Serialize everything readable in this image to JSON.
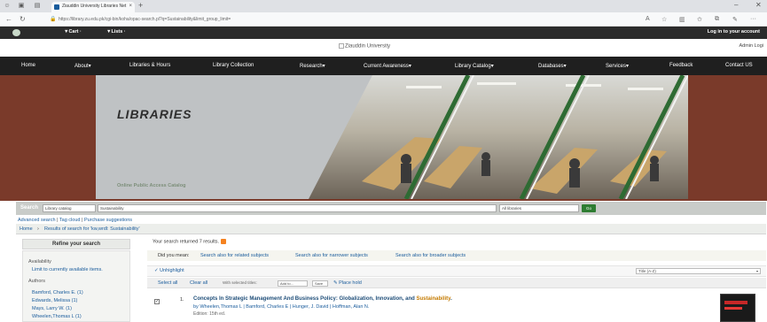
{
  "browser": {
    "tab_title": "Ziauddin University Libraries Net",
    "url": "https://library.zu.edu.pk/cgi-bin/koha/opac-search.pl?q=Sustainability&limit_group_limit=",
    "new_tab": "+",
    "minimize": "–",
    "close": "✕"
  },
  "topbar": {
    "cart": "▼Cart ·",
    "lists": "▼Lists ·",
    "login": "Log in to your account"
  },
  "brand": {
    "banner_alt": "Ziauddin University",
    "admin_login": "Admin Logi"
  },
  "nav": [
    "Home",
    "About▾",
    "Libraries & Hours",
    "Library Collection",
    "Research▾",
    "Current Awareness▾",
    "Library Catalog▾",
    "Databases▾",
    "Services▾",
    "Feedback",
    "Contact US"
  ],
  "hero": {
    "heading": "LIBRARIES",
    "subheading": "Online Public Access Catalog"
  },
  "search": {
    "label": "Search",
    "scope": "Library catalog",
    "query": "Sustainability",
    "branch": "All libraries",
    "go": "Go"
  },
  "links": {
    "advanced": "Advanced search",
    "tag_cloud": "Tag cloud",
    "purchase": "Purchase suggestions",
    "separator": " | "
  },
  "breadcrumb": {
    "home": "Home",
    "arrow": "›",
    "current": "Results of search for 'kw,wrdl: Sustainability'"
  },
  "refine": {
    "title": "Refine your search",
    "availability_heading": "Availability",
    "availability_link": "Limit to currently available items.",
    "authors_heading": "Authors",
    "authors": [
      "Bamford, Charles E. (1)",
      "Edwards, Melissa (1)",
      "Mays, Larry W. (1)",
      "Wheelen,Thomas L (1)"
    ]
  },
  "results": {
    "summary": "Your search returned 7 results.",
    "did_you_mean": "Did you mean:",
    "suggestions": [
      "Search also for related subjects",
      "Search also for narrower subjects",
      "Search also for broader subjects"
    ],
    "unhighlight": "✓ Unhighlight",
    "sort": "Title (A-Z)",
    "select_all": "Select all",
    "clear_all": "Clear all",
    "with_selected": "With selected titles:",
    "add_to": "Add to...",
    "save": "Save",
    "place_hold": "Place hold",
    "items": [
      {
        "number": "1.",
        "title_pre": "Concepts In Strategic Management And Business Policy: Globalization, Innovation, and ",
        "title_hl": "Sustainability",
        "title_post": ".",
        "authors": "by Wheelen,Thomas L | Bamford, Charles E | Hunger, J. David | Hoffman, Alan N.",
        "edition": "Edition: 15th ed."
      }
    ]
  },
  "colors": {
    "topbar": "#2b2b2b",
    "nav": "#1f1f1f",
    "hero_frame": "#7a3a2a",
    "go_button": "#2e7d32",
    "link": "#1a5c9c",
    "highlight": "#c47a00"
  }
}
